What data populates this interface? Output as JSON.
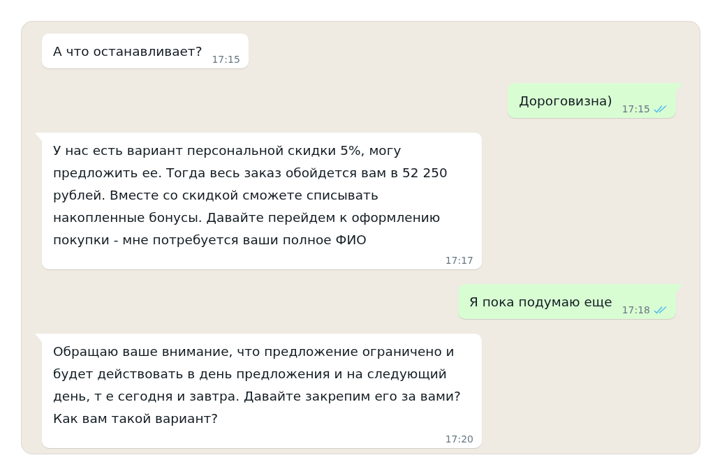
{
  "messages": [
    {
      "kind": "incoming",
      "tail": false,
      "text": "А что останавливает?",
      "time": "17:15"
    },
    {
      "kind": "outgoing",
      "tail": true,
      "text": "Дороговизна)",
      "time": "17:15",
      "read": true
    },
    {
      "kind": "incoming",
      "tail": true,
      "text": "У нас есть вариант персональной скидки 5%, могу предложить ее. Тогда весь заказ обойдется вам в 52 250 рублей. Вместе со скидкой сможете списывать накопленные бонусы. Давайте перейдем к оформлению покупки - мне потребуется ваши полное ФИО",
      "time": "17:17"
    },
    {
      "kind": "outgoing",
      "tail": true,
      "text": "Я пока подумаю еще",
      "time": "17:18",
      "read": true
    },
    {
      "kind": "incoming",
      "tail": true,
      "text": "Обращаю ваше внимание, что предложение ограничено и будет действовать в день предложения и на следующий день, т е сегодня и завтра. Давайте закрепим его за вами? Как вам такой вариант?",
      "time": "17:20"
    }
  ]
}
